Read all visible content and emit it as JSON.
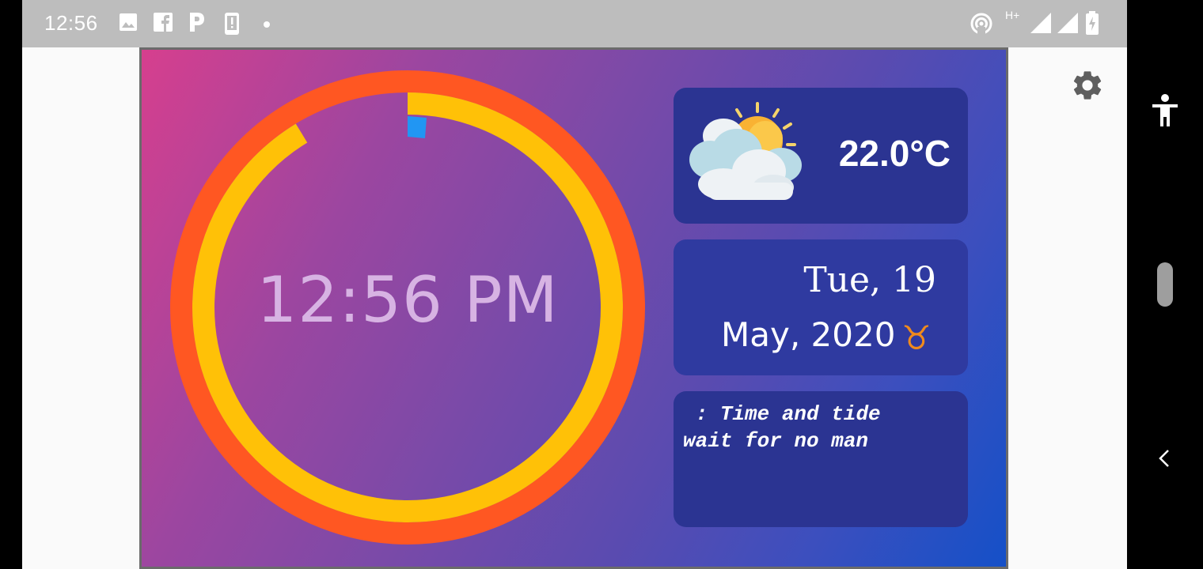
{
  "status_bar": {
    "time": "12:56",
    "icons": [
      "image-icon",
      "facebook-icon",
      "parking-icon",
      "phone-alert-icon",
      "dot-icon",
      "hotspot-icon",
      "hplus-network-icon",
      "signal-icon",
      "signal-icon",
      "battery-charging-icon"
    ],
    "network_label": "H+"
  },
  "clock": {
    "time": "12:56 PM",
    "outer_ring_color": "#ff5722",
    "inner_ring_color": "#ffc107",
    "marker_color": "#2196f3"
  },
  "weather": {
    "icon": "partly-cloudy-sun-icon",
    "temperature": "22.0°C"
  },
  "date": {
    "line1": "Tue, 19",
    "line2": "May, 2020",
    "zodiac_symbol": "♉",
    "zodiac_color": "#f08a1c"
  },
  "quote": {
    "text": " : Time and tide\nwait for no man"
  },
  "toolbar": {
    "settings_icon": "gear-icon"
  },
  "navigation": {
    "items": [
      "accessibility-icon",
      "back-icon"
    ]
  },
  "colors": {
    "card_background": "#2b3492",
    "status_bar": "#bdbdbd"
  }
}
